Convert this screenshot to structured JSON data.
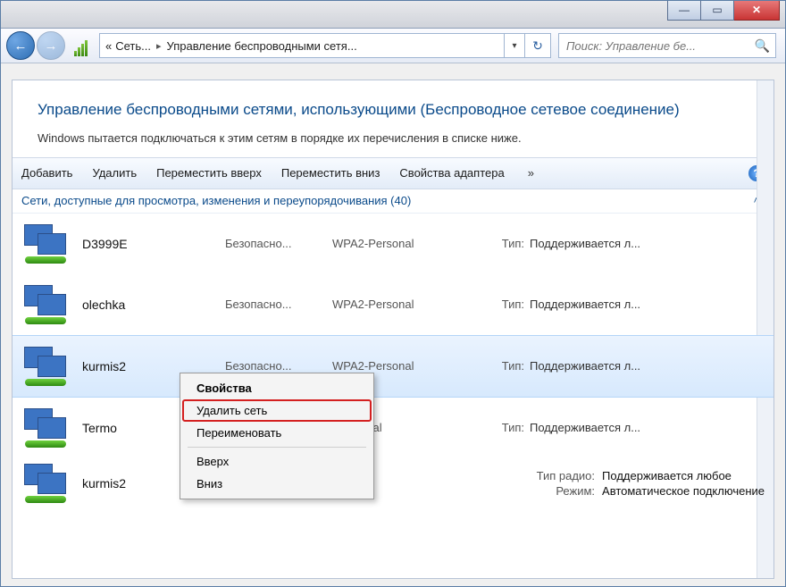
{
  "titlebar": {
    "minimize": "—",
    "maximize": "▭",
    "close": "✕"
  },
  "nav": {
    "back": "←",
    "forward": "→",
    "crumb1": "Сеть...",
    "crumb2": "Управление беспроводными сетя...",
    "dd": "▾",
    "refresh": "↻",
    "search_placeholder": "Поиск: Управление бе..."
  },
  "header": {
    "title": "Управление беспроводными сетями, использующими (Беспроводное сетевое соединение)",
    "subtitle": "Windows пытается подключаться к этим сетям в порядке их перечисления в списке ниже."
  },
  "toolbar": {
    "add": "Добавить",
    "delete": "Удалить",
    "move_up": "Переместить вверх",
    "move_down": "Переместить вниз",
    "adapter_props": "Свойства адаптера",
    "more": "»",
    "help": "?"
  },
  "group": {
    "label": "Сети, доступные для просмотра, изменения и переупорядочивания (40)",
    "collapse": "˄"
  },
  "cols": {
    "security": "Безопасно...",
    "wpa2": "WPA2-Personal",
    "personal_trunc": "-Personal",
    "onal_trunc": "onal",
    "type_label": "Тип:",
    "type_value": "Поддерживается л..."
  },
  "networks": [
    {
      "name": "D3999E"
    },
    {
      "name": "olechka"
    },
    {
      "name": "kurmis2"
    },
    {
      "name": "Termo"
    },
    {
      "name": "kurmis2"
    }
  ],
  "ctx": {
    "properties": "Свойства",
    "delete_net": "Удалить сеть",
    "rename": "Переименовать",
    "up": "Вверх",
    "down": "Вниз"
  },
  "info": {
    "radio_label": "Тип радио:",
    "radio_value": "Поддерживается любое",
    "mode_label": "Режим:",
    "mode_value": "Автоматическое подключение"
  }
}
